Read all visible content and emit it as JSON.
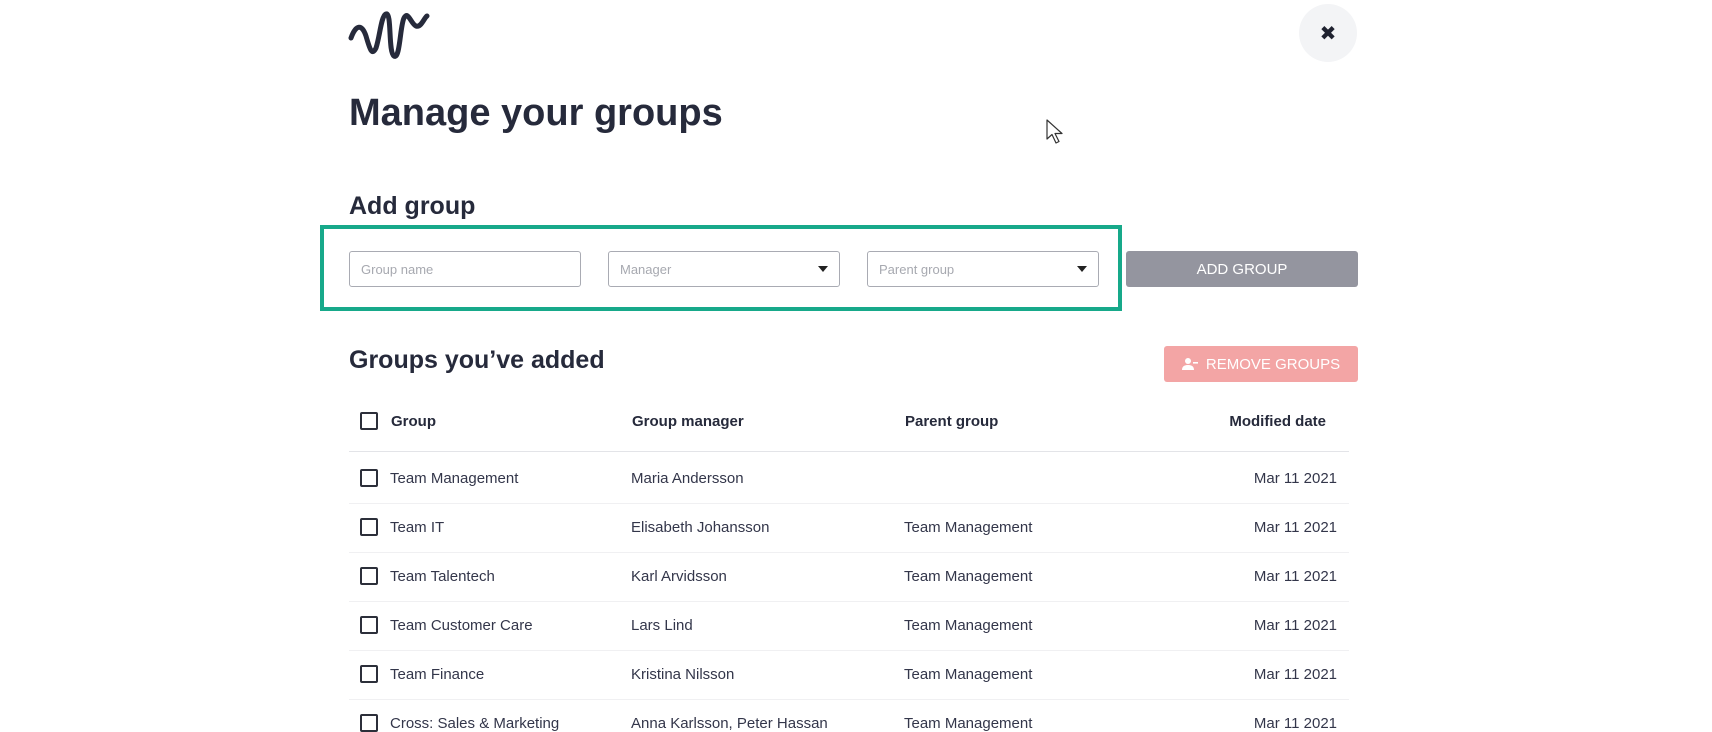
{
  "logo": {
    "icon": "wave-logo-icon"
  },
  "close": {
    "icon": "close-icon",
    "glyph": "✖"
  },
  "page": {
    "title": "Manage your groups"
  },
  "add_group": {
    "title": "Add group",
    "group_name_placeholder": "Group name",
    "manager_placeholder": "Manager",
    "parent_placeholder": "Parent group",
    "add_button": "ADD GROUP"
  },
  "groups": {
    "title": "Groups you’ve added",
    "remove_button": "REMOVE GROUPS",
    "remove_icon": "remove-user-icon",
    "columns": {
      "group": "Group",
      "manager": "Group manager",
      "parent": "Parent group",
      "modified": "Modified date"
    },
    "rows": [
      {
        "group": "Team Management",
        "manager": "Maria Andersson",
        "parent": "",
        "modified": "Mar 11 2021"
      },
      {
        "group": "Team IT",
        "manager": "Elisabeth Johansson",
        "parent": "Team Management",
        "modified": "Mar 11 2021"
      },
      {
        "group": "Team Talentech",
        "manager": "Karl Arvidsson",
        "parent": "Team Management",
        "modified": "Mar 11 2021"
      },
      {
        "group": "Team Customer Care",
        "manager": "Lars Lind",
        "parent": "Team Management",
        "modified": "Mar 11 2021"
      },
      {
        "group": "Team Finance",
        "manager": "Kristina Nilsson",
        "parent": "Team Management",
        "modified": "Mar 11 2021"
      },
      {
        "group": "Cross: Sales & Marketing",
        "manager": "Anna Karlsson, Peter Hassan",
        "parent": "Team Management",
        "modified": "Mar 11 2021"
      }
    ]
  },
  "colors": {
    "highlight": "#17a98a",
    "add_button": "#94959f",
    "remove_button": "#f3a5a5",
    "text": "#262a3b"
  }
}
